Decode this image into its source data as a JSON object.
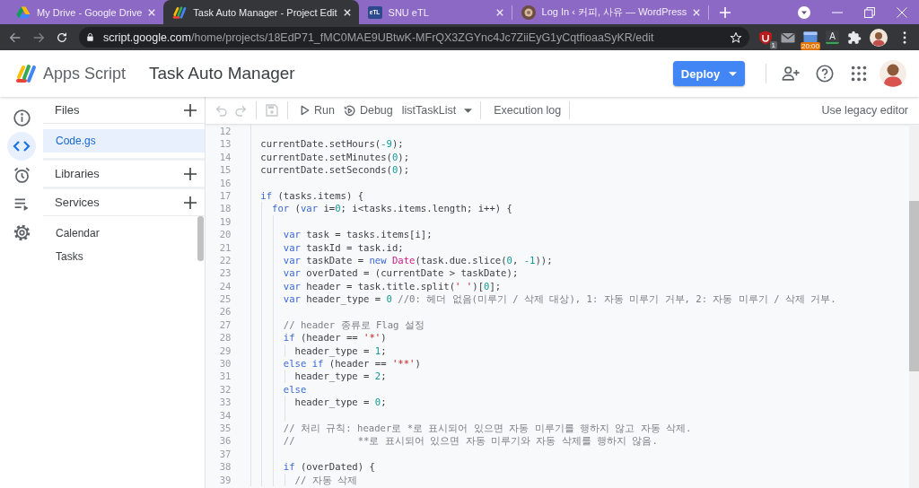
{
  "browser": {
    "tabs": [
      {
        "title": "My Drive - Google Drive",
        "favicon": {
          "kind": "drive"
        },
        "selected": false
      },
      {
        "title": "Task Auto Manager - Project Edit",
        "favicon": {
          "kind": "pinwheel"
        },
        "selected": true
      },
      {
        "title": "SNU eTL",
        "favicon": {
          "kind": "tile",
          "text": "eTL"
        },
        "selected": false
      },
      {
        "title": "Log In ‹ 커피, 사유 — WordPress",
        "favicon": {
          "kind": "round"
        },
        "selected": false
      }
    ],
    "url": {
      "host": "script.google.com",
      "path": "/home/projects/18EdP71_fMC0MAE9UBtwK-MFrQX3ZGYnc4Jc7ZiiEyG1yCqtfioaaSyKR/edit"
    },
    "extensions": [
      {
        "kind": "shield",
        "badge": "1"
      },
      {
        "kind": "mail"
      },
      {
        "kind": "screen",
        "badge": "20:00"
      },
      {
        "kind": "letter",
        "text": "A"
      },
      {
        "kind": "puzzle"
      },
      {
        "kind": "avatar"
      }
    ]
  },
  "header": {
    "product": "Apps Script",
    "project": "Task Auto Manager",
    "deploy": "Deploy"
  },
  "rail": [
    {
      "kind": "info",
      "selected": false
    },
    {
      "kind": "code",
      "selected": true
    },
    {
      "kind": "alarm",
      "selected": false
    },
    {
      "kind": "executions",
      "selected": false
    },
    {
      "kind": "settings",
      "selected": false
    }
  ],
  "sidebar": {
    "sections": [
      {
        "title": "Files",
        "items": [
          {
            "name": "Code.gs",
            "selected": true
          }
        ]
      },
      {
        "title": "Libraries"
      },
      {
        "title": "Services",
        "items": [
          {
            "name": "Calendar",
            "selected": false
          },
          {
            "name": "Tasks",
            "selected": false
          }
        ]
      }
    ]
  },
  "toolbar": {
    "groups": [
      [
        {
          "kind": "undo",
          "disabled": true
        },
        {
          "kind": "redo",
          "disabled": true
        }
      ],
      [
        {
          "kind": "save",
          "disabled": true
        }
      ],
      [
        {
          "kind": "run",
          "label": "Run"
        },
        {
          "kind": "debug",
          "label": "Debug"
        },
        {
          "kind": "menu",
          "label": "listTaskList"
        }
      ],
      [
        {
          "kind": "text",
          "label": "Execution log"
        }
      ]
    ],
    "legacy": "Use legacy editor"
  },
  "editor": {
    "lines": [
      {
        "number": "12"
      },
      {
        "number": "13",
        "tokens": [
          {
            "kind": "plain",
            "text": "currentDate.setHours("
          },
          {
            "kind": "number",
            "text": "-9"
          },
          {
            "kind": "plain",
            "text": ");"
          }
        ]
      },
      {
        "number": "14",
        "tokens": [
          {
            "kind": "plain",
            "text": "currentDate.setMinutes("
          },
          {
            "kind": "number",
            "text": "0"
          },
          {
            "kind": "plain",
            "text": ");"
          }
        ]
      },
      {
        "number": "15",
        "tokens": [
          {
            "kind": "plain",
            "text": "currentDate.setSeconds("
          },
          {
            "kind": "number",
            "text": "0"
          },
          {
            "kind": "plain",
            "text": ");"
          }
        ]
      },
      {
        "number": "16"
      },
      {
        "number": "17",
        "tokens": [
          {
            "kind": "keyword",
            "text": "if"
          },
          {
            "kind": "plain",
            "text": " (tasks.items) {"
          }
        ],
        "children": [
          {
            "number": "18",
            "tokens": [
              {
                "kind": "keyword",
                "text": "for"
              },
              {
                "kind": "plain",
                "text": " ("
              },
              {
                "kind": "keyword",
                "text": "var"
              },
              {
                "kind": "plain",
                "text": " i="
              },
              {
                "kind": "number",
                "text": "0"
              },
              {
                "kind": "plain",
                "text": "; i<tasks.items.length; i++) {"
              }
            ],
            "children": [
              {
                "number": "19"
              },
              {
                "number": "20",
                "tokens": [
                  {
                    "kind": "keyword",
                    "text": "var"
                  },
                  {
                    "kind": "plain",
                    "text": " task = tasks.items[i];"
                  }
                ]
              },
              {
                "number": "21",
                "tokens": [
                  {
                    "kind": "keyword",
                    "text": "var"
                  },
                  {
                    "kind": "plain",
                    "text": " taskId = task.id;"
                  }
                ]
              },
              {
                "number": "22",
                "tokens": [
                  {
                    "kind": "keyword",
                    "text": "var"
                  },
                  {
                    "kind": "plain",
                    "text": " taskDate = "
                  },
                  {
                    "kind": "keyword",
                    "text": "new "
                  },
                  {
                    "kind": "builtin",
                    "text": "Date"
                  },
                  {
                    "kind": "plain",
                    "text": "(task.due.slice("
                  },
                  {
                    "kind": "number",
                    "text": "0"
                  },
                  {
                    "kind": "plain",
                    "text": ", "
                  },
                  {
                    "kind": "number",
                    "text": "-1"
                  },
                  {
                    "kind": "plain",
                    "text": "));"
                  }
                ]
              },
              {
                "number": "23",
                "tokens": [
                  {
                    "kind": "keyword",
                    "text": "var"
                  },
                  {
                    "kind": "plain",
                    "text": " overDated = (currentDate > taskDate);"
                  }
                ]
              },
              {
                "number": "24",
                "tokens": [
                  {
                    "kind": "keyword",
                    "text": "var"
                  },
                  {
                    "kind": "plain",
                    "text": " header = task.title.split("
                  },
                  {
                    "kind": "string",
                    "text": "' '"
                  },
                  {
                    "kind": "plain",
                    "text": ")["
                  },
                  {
                    "kind": "number",
                    "text": "0"
                  },
                  {
                    "kind": "plain",
                    "text": "];"
                  }
                ]
              },
              {
                "number": "25",
                "tokens": [
                  {
                    "kind": "keyword",
                    "text": "var"
                  },
                  {
                    "kind": "plain",
                    "text": " header_type = "
                  },
                  {
                    "kind": "number",
                    "text": "0"
                  },
                  {
                    "kind": "comment",
                    "text": " //0: 헤더 없음(미루기 / 삭제 대상), 1: 자동 미루기 거부, 2: 자동 미루기 / 삭제 거부."
                  }
                ]
              },
              {
                "number": "26"
              },
              {
                "number": "27",
                "tokens": [
                  {
                    "kind": "comment",
                    "text": "// header 종류로 Flag 설정"
                  }
                ]
              },
              {
                "number": "28",
                "tokens": [
                  {
                    "kind": "keyword",
                    "text": "if"
                  },
                  {
                    "kind": "plain",
                    "text": " (header == "
                  },
                  {
                    "kind": "string",
                    "text": "'*'"
                  },
                  {
                    "kind": "plain",
                    "text": ")"
                  }
                ],
                "children": [
                  {
                    "number": "29",
                    "tokens": [
                      {
                        "kind": "plain",
                        "text": "header_type = "
                      },
                      {
                        "kind": "number",
                        "text": "1"
                      },
                      {
                        "kind": "plain",
                        "text": ";"
                      }
                    ]
                  }
                ]
              },
              {
                "number": "30",
                "tokens": [
                  {
                    "kind": "keyword",
                    "text": "else if"
                  },
                  {
                    "kind": "plain",
                    "text": " (header == "
                  },
                  {
                    "kind": "string",
                    "text": "'**'"
                  },
                  {
                    "kind": "plain",
                    "text": ")"
                  }
                ],
                "children": [
                  {
                    "number": "31",
                    "tokens": [
                      {
                        "kind": "plain",
                        "text": "header_type = "
                      },
                      {
                        "kind": "number",
                        "text": "2"
                      },
                      {
                        "kind": "plain",
                        "text": ";"
                      }
                    ]
                  }
                ]
              },
              {
                "number": "32",
                "tokens": [
                  {
                    "kind": "keyword",
                    "text": "else"
                  }
                ],
                "children": [
                  {
                    "number": "33",
                    "tokens": [
                      {
                        "kind": "plain",
                        "text": "header_type = "
                      },
                      {
                        "kind": "number",
                        "text": "0"
                      },
                      {
                        "kind": "plain",
                        "text": ";"
                      }
                    ]
                  },
                  {
                    "number": "34"
                  }
                ]
              },
              {
                "number": "35",
                "tokens": [
                  {
                    "kind": "comment",
                    "text": "// 처리 규칙: header로 *로 표시되어 있으면 자동 미루기를 행하지 않고 자동 삭제."
                  }
                ]
              },
              {
                "number": "36",
                "tokens": [
                  {
                    "kind": "comment",
                    "text": "//           **로 표시되어 있으면 자동 미루기와 자동 삭제를 행하지 않음."
                  }
                ]
              },
              {
                "number": "37"
              },
              {
                "number": "38",
                "tokens": [
                  {
                    "kind": "keyword",
                    "text": "if"
                  },
                  {
                    "kind": "plain",
                    "text": " (overDated) {"
                  }
                ],
                "children": [
                  {
                    "number": "39",
                    "tokens": [
                      {
                        "kind": "comment",
                        "text": "// 자동 삭제"
                      }
                    ]
                  }
                ]
              }
            ]
          }
        ]
      }
    ]
  }
}
